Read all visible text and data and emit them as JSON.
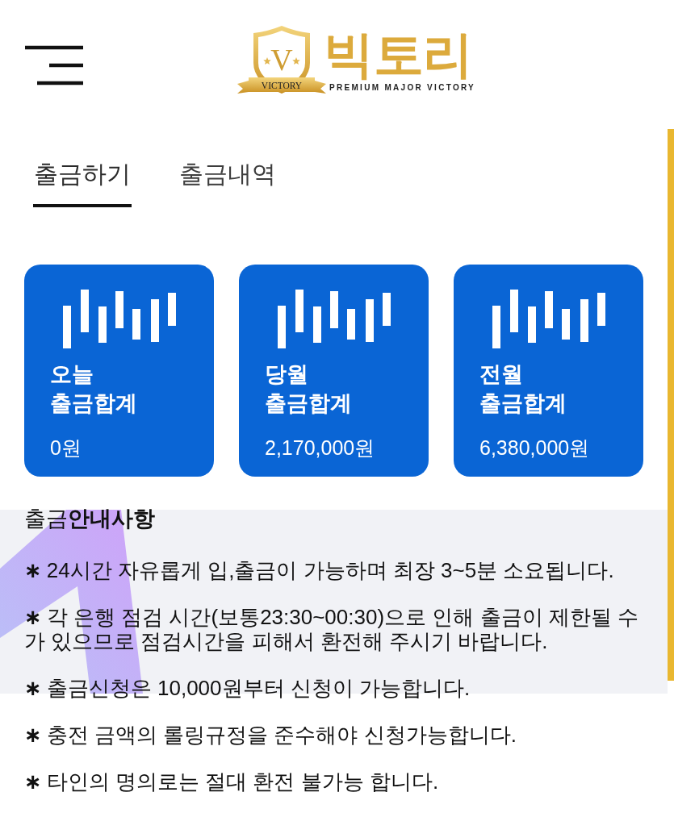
{
  "logo": {
    "emblem_letter": "V",
    "ribbon_text": "VICTORY",
    "name": "빅토리",
    "tagline": "PREMIUM MAJOR VICTORY"
  },
  "tabs": [
    {
      "label": "출금하기",
      "selected": true
    },
    {
      "label": "출금내역",
      "selected": false
    }
  ],
  "summary_cards": [
    {
      "period": "오늘",
      "label": "출금합계",
      "amount": "0원"
    },
    {
      "period": "당월",
      "label": "출금합계",
      "amount": "2,170,000원"
    },
    {
      "period": "전월",
      "label": "출금합계",
      "amount": "6,380,000원"
    }
  ],
  "notice": {
    "title": "출금**안내사항**",
    "items": [
      {
        "marker": "∗",
        "text": "24시간 자유롭게 입,출금이 가능하며 최장 3~5분 소요됩니다."
      },
      {
        "marker": "∗",
        "text": "각 은행 점검 시간(보통23:30~00:30)으로 인해 출금이 제한될 수가 있으므로 점검시간을 피해서 환전해 주시기 바랍니다."
      },
      {
        "marker": "∗",
        "text": "출금신청은 10,000원부터 신청이 가능합니다."
      },
      {
        "marker": "∗",
        "text": "충전 금액의 롤링규정을 준수해야 신청가능합니다."
      },
      {
        "marker": "∗",
        "text": "타인의 명의로는 절대 환전 불가능 합니다."
      }
    ]
  }
}
